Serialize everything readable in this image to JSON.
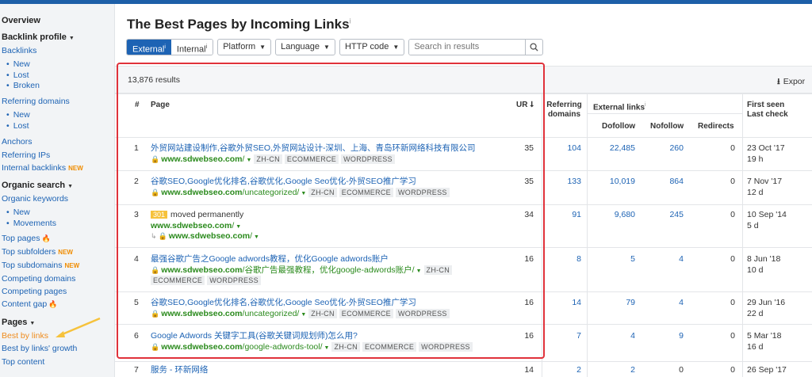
{
  "sidebar": {
    "overview": "Overview",
    "backlink_profile": "Backlink profile",
    "backlinks": "Backlinks",
    "new": "New",
    "lost": "Lost",
    "broken": "Broken",
    "referring_domains": "Referring domains",
    "rd_new": "New",
    "rd_lost": "Lost",
    "anchors": "Anchors",
    "referring_ips": "Referring IPs",
    "internal_backlinks": "Internal backlinks",
    "new_badge": "NEW",
    "organic_search": "Organic search",
    "organic_keywords": "Organic keywords",
    "ok_new": "New",
    "movements": "Movements",
    "top_pages": "Top pages",
    "top_subfolders": "Top subfolders",
    "top_subdomains": "Top subdomains",
    "competing_domains": "Competing domains",
    "competing_pages": "Competing pages",
    "content_gap": "Content gap",
    "pages": "Pages",
    "best_by_links": "Best by links",
    "best_by_links_growth": "Best by links' growth",
    "top_content": "Top content"
  },
  "main": {
    "title": "The Best Pages by Incoming Links",
    "title_info": "i",
    "filters": {
      "external": "External",
      "internal": "Internal",
      "info": "i",
      "platform": "Platform",
      "language": "Language",
      "http_code": "HTTP code",
      "search_placeholder": "Search in results"
    },
    "results_count": "13,876 results",
    "export": "Expor"
  },
  "table": {
    "headers": {
      "index": "#",
      "page": "Page",
      "ur": "UR",
      "referring_domains": "Referring domains",
      "external_links": "External links",
      "dofollow": "Dofollow",
      "nofollow": "Nofollow",
      "redirects": "Redirects",
      "first_seen": "First seen",
      "last_check": "Last check"
    },
    "rows": [
      {
        "n": "1",
        "title": "外贸网站建设制作,谷歌外贸SEO,外贸网站设计-深圳、上海、青岛环新网络科技有限公司",
        "domain": "www.sdwebseo.com",
        "path": "/",
        "tags": [
          "ZH-CN",
          "ECOMMERCE",
          "WORDPRESS"
        ],
        "ur": "35",
        "rd": "104",
        "dofollow": "22,485",
        "nofollow": "260",
        "redirects": "0",
        "first_seen": "23 Oct '17",
        "last_check": "19 h"
      },
      {
        "n": "2",
        "title": "谷歌SEO,Google优化排名,谷歌优化,Google Seo优化-外贸SEO推广学习",
        "domain": "www.sdwebseo.com",
        "path": "/uncategorized/",
        "tags": [
          "ZH-CN",
          "ECOMMERCE",
          "WORDPRESS"
        ],
        "ur": "35",
        "rd": "133",
        "dofollow": "10,019",
        "nofollow": "864",
        "redirects": "0",
        "first_seen": "7 Nov '17",
        "last_check": "12 d"
      },
      {
        "n": "3",
        "badge": "301",
        "title": "moved permanently",
        "domain": "www.sdwebseo.com",
        "path": "/",
        "redirect_domain": "www.sdwebseo.com",
        "redirect_path": "/",
        "ur": "34",
        "rd": "91",
        "dofollow": "9,680",
        "nofollow": "245",
        "redirects": "0",
        "first_seen": "10 Sep '14",
        "last_check": "5 d"
      },
      {
        "n": "4",
        "title": "最强谷歌广告之Google adwords教程，优化Google adwords账户",
        "domain": "www.sdwebseo.com",
        "path": "/谷歌广告最强教程，优化google-adwords账户/",
        "tags_inline": [
          "ZH-CN"
        ],
        "tags": [
          "ECOMMERCE",
          "WORDPRESS"
        ],
        "ur": "16",
        "rd": "8",
        "dofollow": "5",
        "nofollow": "4",
        "redirects": "0",
        "first_seen": "8 Jun '18",
        "last_check": "10 d"
      },
      {
        "n": "5",
        "title": "谷歌SEO,Google优化排名,谷歌优化,Google Seo优化-外贸SEO推广学习",
        "domain": "www.sdwebseo.com",
        "path": "/uncategorized/",
        "tags": [
          "ZH-CN",
          "ECOMMERCE",
          "WORDPRESS"
        ],
        "ur": "16",
        "rd": "14",
        "dofollow": "79",
        "nofollow": "4",
        "redirects": "0",
        "first_seen": "29 Jun '16",
        "last_check": "22 d"
      },
      {
        "n": "6",
        "title": "Google Adwords 关键字工具(谷歌关键词规划师)怎么用?",
        "domain": "www.sdwebseo.com",
        "path": "/google-adwords-tool/",
        "tags": [
          "ZH-CN",
          "ECOMMERCE",
          "WORDPRESS"
        ],
        "ur": "16",
        "rd": "7",
        "dofollow": "4",
        "nofollow": "9",
        "redirects": "0",
        "first_seen": "5 Mar '18",
        "last_check": "16 d"
      },
      {
        "n": "7",
        "title": "服务 - 环新网络",
        "ur": "14",
        "rd": "2",
        "dofollow": "2",
        "nofollow": "0",
        "redirects": "0",
        "first_seen": "26 Sep '17"
      }
    ]
  },
  "colors": {
    "link": "#1d63b4",
    "url_green": "#2a8a1c",
    "active_nav": "#ef8b1c",
    "highlight_border": "#e0323b",
    "top_bar": "#1d5fa8"
  }
}
